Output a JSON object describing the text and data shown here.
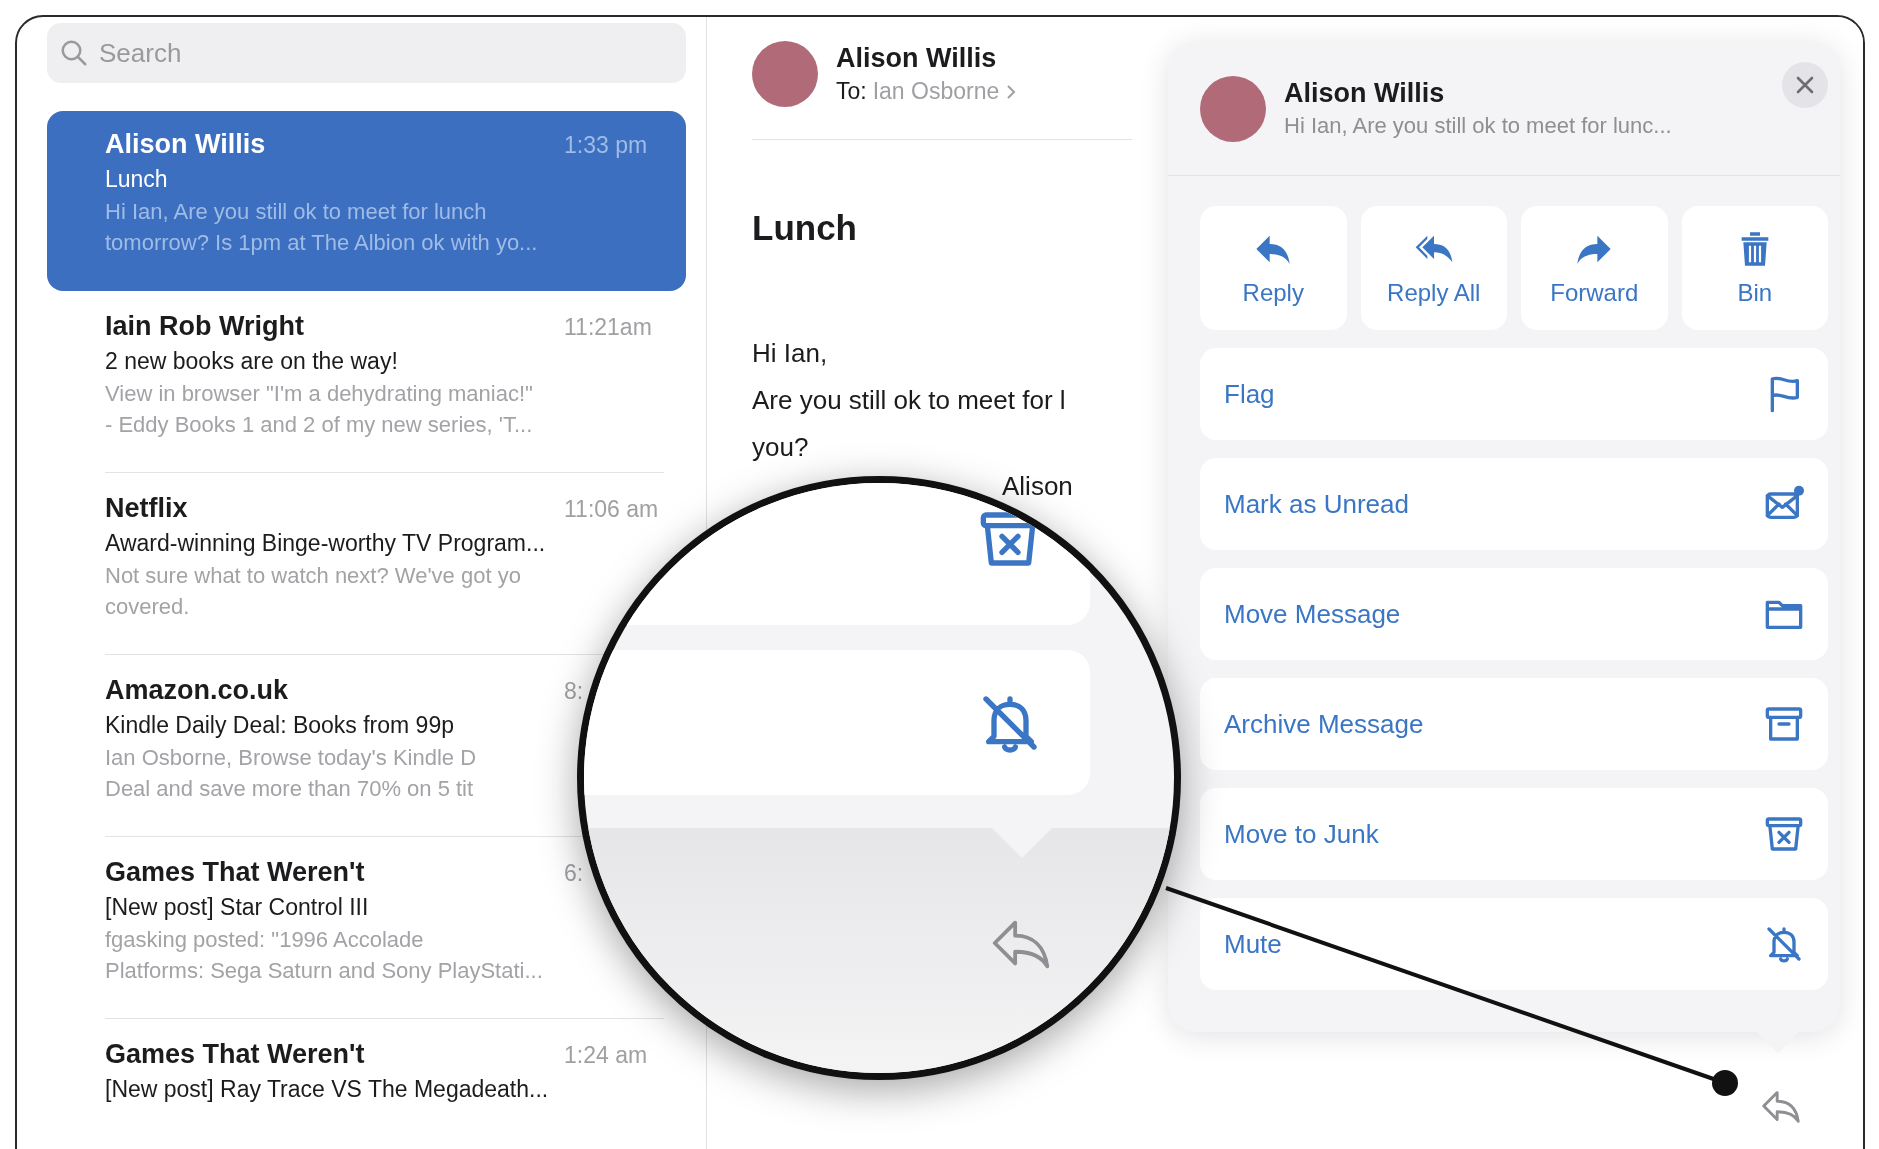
{
  "search": {
    "placeholder": "Search"
  },
  "messages": [
    {
      "sender": "Alison Willis",
      "time": "1:33 pm",
      "subject": "Lunch",
      "preview": [
        "Hi Ian, Are you still ok to meet for lunch",
        "tomorrow? Is 1pm at The Albion ok with yo..."
      ],
      "selected": true
    },
    {
      "sender": "Iain Rob Wright",
      "time": "11:21am",
      "subject": "2 new books are on the way!",
      "preview": [
        "View in browser \"I'm a dehydrating maniac!\"",
        "- Eddy Books 1 and 2 of my new series, 'T..."
      ],
      "selected": false
    },
    {
      "sender": "Netflix",
      "time": "11:06 am",
      "subject": "Award-winning Binge-worthy TV Program...",
      "preview": [
        "Not sure what to watch next? We've got yo",
        "covered."
      ],
      "selected": false
    },
    {
      "sender": "Amazon.co.uk",
      "time": "8:",
      "subject": "Kindle Daily Deal: Books from 99p",
      "preview": [
        "Ian Osborne, Browse today's Kindle D",
        "Deal and save more than 70% on 5 tit"
      ],
      "selected": false
    },
    {
      "sender": "Games That Weren't",
      "time": "6:",
      "subject": "[New post] Star Control III",
      "preview": [
        "fgasking posted: \"1996 Accolade",
        "Platforms: Sega Saturn and Sony PlayStati..."
      ],
      "selected": false
    },
    {
      "sender": "Games That Weren't",
      "time": "1:24 am",
      "subject": "[New post] Ray Trace VS The Megadeath...",
      "selected": false
    }
  ],
  "message": {
    "sender": "Alison Willis",
    "to_label": "To:",
    "to": "Ian Osborne",
    "subject": "Lunch",
    "body": [
      "Hi Ian,",
      "Are you still ok to meet for l",
      "you?"
    ],
    "signature": "Alison"
  },
  "action_sheet": {
    "sender": "Alison Willis",
    "preview": "Hi Ian, Are you still ok to meet for lunc...",
    "quick_actions": [
      {
        "label": "Reply",
        "kind": "reply"
      },
      {
        "label": "Reply All",
        "kind": "reply-all"
      },
      {
        "label": "Forward",
        "kind": "forward"
      },
      {
        "label": "Bin",
        "kind": "bin"
      }
    ],
    "actions": [
      {
        "label": "Flag",
        "kind": "flag"
      },
      {
        "label": "Mark as Unread",
        "kind": "unread"
      },
      {
        "label": "Move Message",
        "kind": "folder"
      },
      {
        "label": "Archive Message",
        "kind": "archive"
      },
      {
        "label": "Move to Junk",
        "kind": "junk"
      },
      {
        "label": "Mute",
        "kind": "mute"
      }
    ]
  }
}
